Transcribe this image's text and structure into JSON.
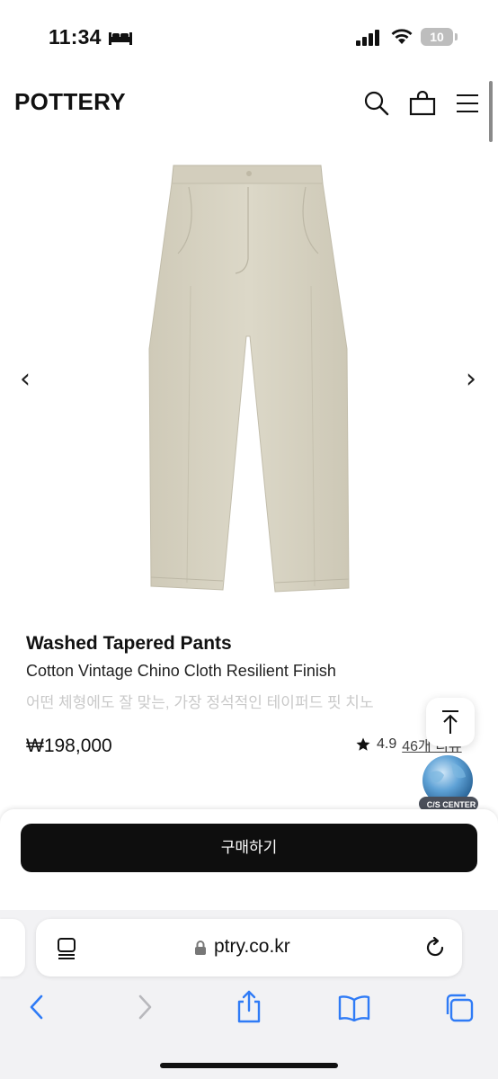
{
  "status_bar": {
    "time": "11:34",
    "battery": "10"
  },
  "header": {
    "logo": "POTTERY"
  },
  "product": {
    "name": "Washed Tapered Pants",
    "subtitle": "Cotton Vintage Chino Cloth Resilient Finish",
    "description": "어떤 체형에도 잘 맞는, 가장 정석적인 테이퍼드 핏 치노",
    "price": "₩198,000",
    "rating": "4.9",
    "review_link": "46개 리뷰",
    "image_alt": "beige chino pants",
    "pants_color": "#d9d4c3"
  },
  "cs_badge": {
    "label": "C/S CENTER"
  },
  "buy_button": {
    "label": "구매하기"
  },
  "browser": {
    "url": "ptry.co.kr",
    "icons": [
      "tabs-icon",
      "lock-icon",
      "reload-icon",
      "back-icon",
      "forward-icon",
      "share-icon",
      "bookmarks-icon",
      "tab-switcher-icon"
    ]
  },
  "colors": {
    "accent": "#0e0e0e",
    "ios_blue": "#2f7bf6",
    "muted_text": "#c9c9c9"
  }
}
